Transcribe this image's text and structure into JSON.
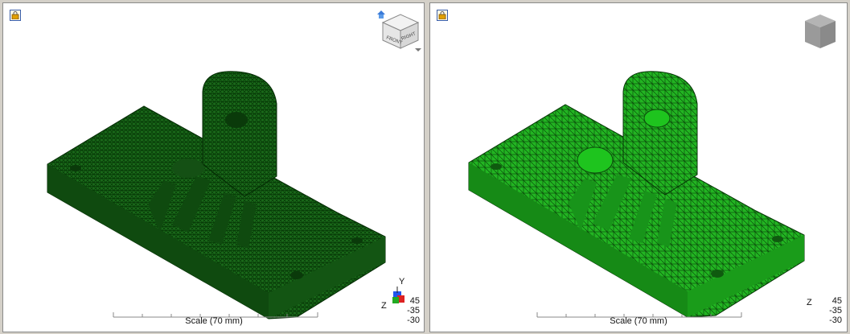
{
  "viewports": [
    {
      "id": "left",
      "navcube_faces": [
        "FRONT",
        "RIGHT"
      ],
      "mesh_fill": "#1a6a1a",
      "mesh_line": "#063806",
      "scale_label": "Scale (70 mm)",
      "axis_labels": {
        "y": "Y",
        "z": "Z"
      },
      "depth_values": [
        "45",
        "-35",
        "-30"
      ]
    },
    {
      "id": "right",
      "mesh_fill": "#1fb21f",
      "mesh_line": "#0b4d0b",
      "scale_label": "Scale (70 mm)",
      "axis_labels": {
        "z": "Z"
      },
      "depth_values": [
        "45",
        "-35",
        "-30"
      ]
    }
  ],
  "icons": [
    "lock-icon",
    "home-icon",
    "navcube-icon",
    "dropdown-arrow-icon",
    "axis-triad-icon"
  ]
}
